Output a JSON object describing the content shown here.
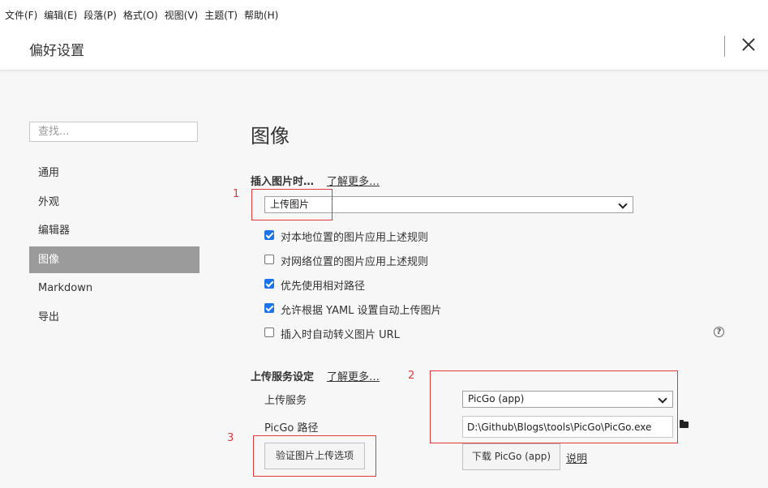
{
  "menu": [
    "文件(F)",
    "编辑(E)",
    "段落(P)",
    "格式(O)",
    "视图(V)",
    "主题(T)",
    "帮助(H)"
  ],
  "header": {
    "title": "偏好设置"
  },
  "sidebar": {
    "search_placeholder": "查找...",
    "items": [
      {
        "label": "通用"
      },
      {
        "label": "外观"
      },
      {
        "label": "编辑器"
      },
      {
        "label": "图像",
        "active": true
      },
      {
        "label": "Markdown"
      },
      {
        "label": "导出"
      }
    ]
  },
  "main": {
    "title": "图像",
    "insert_section": {
      "label": "插入图片时…",
      "learn_more": "了解更多…",
      "action_select": "上传图片",
      "options": [
        {
          "label": "对本地位置的图片应用上述规则",
          "checked": true
        },
        {
          "label": "对网络位置的图片应用上述规则",
          "checked": false
        },
        {
          "label": "优先使用相对路径",
          "checked": true
        },
        {
          "label": "允许根据 YAML 设置自动上传图片",
          "checked": true
        },
        {
          "label": "插入时自动转义图片 URL",
          "checked": false
        }
      ]
    },
    "upload_section": {
      "label": "上传服务设定",
      "learn_more": "了解更多…",
      "service_label": "上传服务",
      "service_value": "PicGo (app)",
      "path_label": "PicGo 路径",
      "path_value": "D:\\Github\\Blogs\\tools\\PicGo\\PicGo.exe",
      "verify_button": "验证图片上传选项",
      "download_button": "下载 PicGo (app)",
      "doc_link": "说明"
    }
  },
  "annotations": [
    "1",
    "2",
    "3"
  ],
  "colors": {
    "active_nav": "#9b9b9b",
    "checkbox": "#1a73e8",
    "annotation": "#e0393b"
  }
}
